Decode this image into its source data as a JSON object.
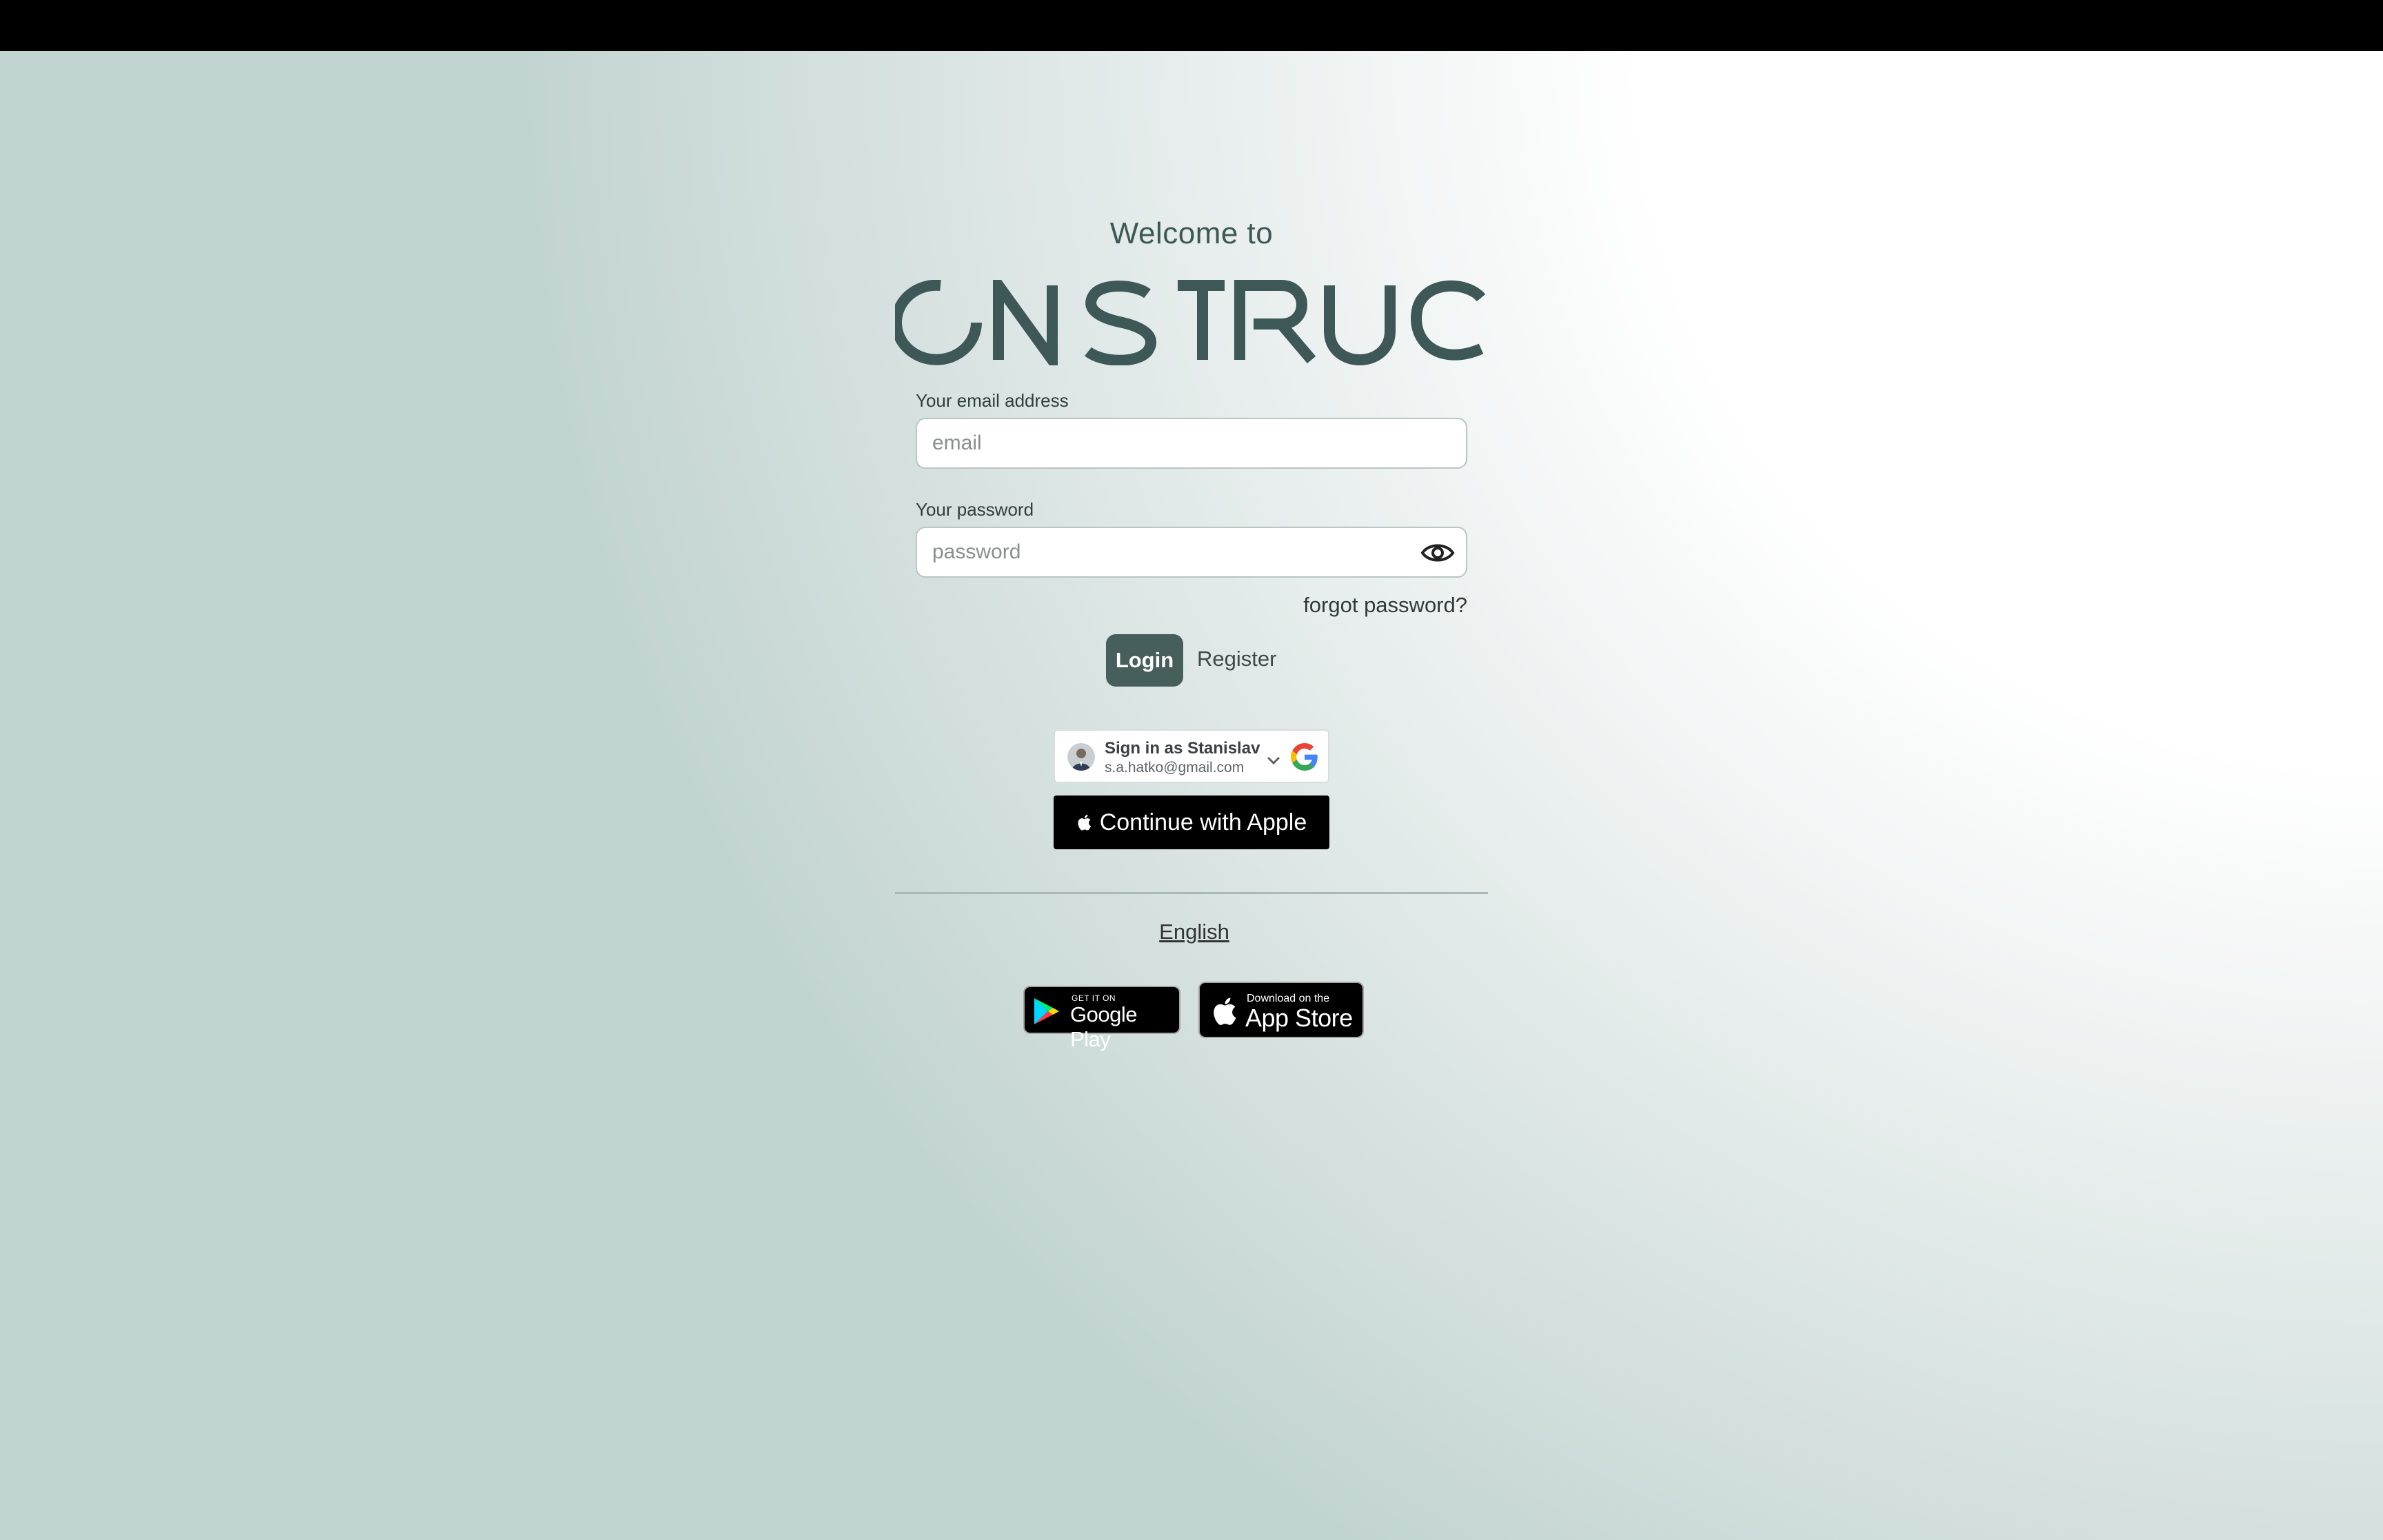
{
  "header": {
    "welcome_text": "Welcome to",
    "logo_text": "ONSTRUC"
  },
  "form": {
    "email_label": "Your email address",
    "email_placeholder": "email",
    "email_value": "",
    "password_label": "Your password",
    "password_placeholder": "password",
    "password_value": "",
    "forgot_link": "forgot password?",
    "login_button": "Login",
    "register_link": "Register"
  },
  "google_signin": {
    "title": "Sign in as Stanislav",
    "email": "s.a.hatko@gmail.com"
  },
  "apple_signin": {
    "label": "Continue with Apple"
  },
  "language": {
    "current": "English"
  },
  "stores": {
    "google_play": {
      "small": "GET IT ON",
      "big": "Google Play"
    },
    "app_store": {
      "small": "Download on the",
      "big": "App Store"
    }
  },
  "colors": {
    "primary": "#465e5c",
    "logo": "#3d5856",
    "top_bar": "#000000"
  },
  "icons": [
    "eye-icon",
    "chevron-down-icon",
    "google-g-icon",
    "apple-icon",
    "google-play-icon"
  ]
}
